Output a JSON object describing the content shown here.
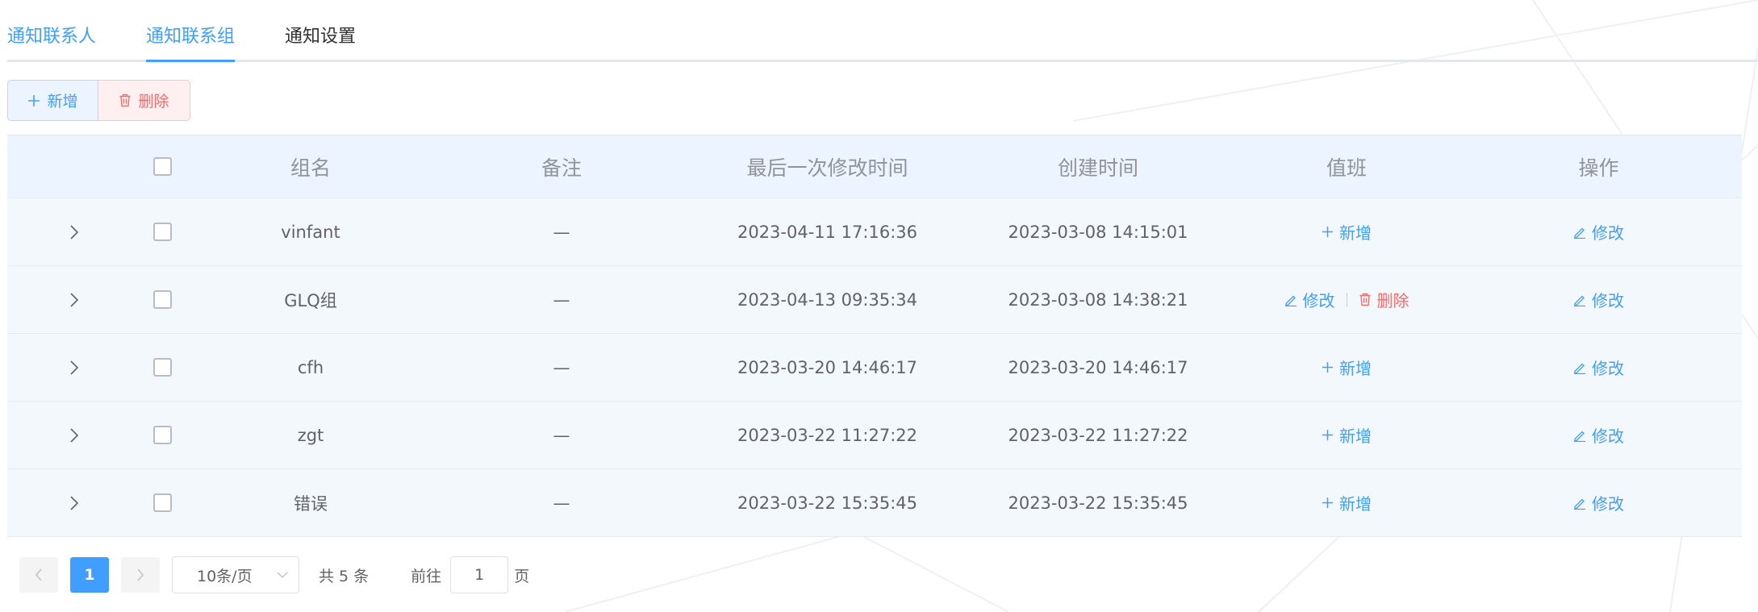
{
  "tabs": [
    {
      "label": "通知联系人"
    },
    {
      "label": "通知联系组"
    },
    {
      "label": "通知设置"
    }
  ],
  "toolbar": {
    "add_label": "新增",
    "delete_label": "删除"
  },
  "table": {
    "headers": {
      "name": "组名",
      "note": "备注",
      "modified": "最后一次修改时间",
      "created": "创建时间",
      "duty": "值班",
      "op": "操作"
    },
    "rows": [
      {
        "name": "vinfant",
        "note": "—",
        "modified": "2023-04-11 17:16:36",
        "created": "2023-03-08 14:15:01",
        "duty_add": "新增",
        "op": "修改"
      },
      {
        "name": "GLQ组",
        "note": "—",
        "modified": "2023-04-13 09:35:34",
        "created": "2023-03-08 14:38:21",
        "duty_edit": "修改",
        "duty_delete": "删除",
        "op": "修改"
      },
      {
        "name": "cfh",
        "note": "—",
        "modified": "2023-03-20 14:46:17",
        "created": "2023-03-20 14:46:17",
        "duty_add": "新增",
        "op": "修改"
      },
      {
        "name": "zgt",
        "note": "—",
        "modified": "2023-03-22 11:27:22",
        "created": "2023-03-22 11:27:22",
        "duty_add": "新增",
        "op": "修改"
      },
      {
        "name": "错误",
        "note": "—",
        "modified": "2023-03-22 15:35:45",
        "created": "2023-03-22 15:35:45",
        "duty_add": "新增",
        "op": "修改"
      }
    ]
  },
  "pagination": {
    "current_page": "1",
    "page_size": "10条/页",
    "total": "共 5 条",
    "goto_prefix": "前往",
    "goto_value": "1",
    "goto_suffix": "页"
  },
  "colors": {
    "accent": "#409eff",
    "danger": "#f56c6c",
    "header_bg": "#ecf5ff",
    "row_bg": "#f3f8fd"
  },
  "icons": {
    "add": "plus-icon",
    "delete": "trash-icon",
    "edit": "pencil-icon",
    "expand": "chevron-right-icon",
    "prev": "chevron-left-icon",
    "next": "chevron-right-icon",
    "dropdown": "chevron-down-icon"
  }
}
